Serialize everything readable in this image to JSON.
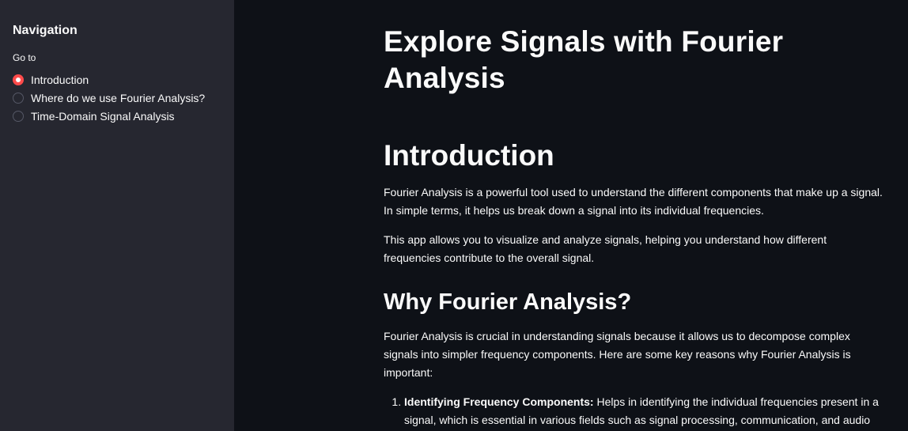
{
  "sidebar": {
    "title": "Navigation",
    "label": "Go to",
    "options": [
      {
        "label": "Introduction",
        "selected": true
      },
      {
        "label": "Where do we use Fourier Analysis?",
        "selected": false
      },
      {
        "label": "Time-Domain Signal Analysis",
        "selected": false
      }
    ]
  },
  "main": {
    "title": "Explore Signals with Fourier Analysis",
    "section_title": "Introduction",
    "intro_para_1": "Fourier Analysis is a powerful tool used to understand the different components that make up a signal. In simple terms, it helps us break down a signal into its individual frequencies.",
    "intro_para_2": "This app allows you to visualize and analyze signals, helping you understand how different frequencies contribute to the overall signal.",
    "why_title": "Why Fourier Analysis?",
    "why_para": "Fourier Analysis is crucial in understanding signals because it allows us to decompose complex signals into simpler frequency components. Here are some key reasons why Fourier Analysis is important:",
    "reasons": [
      {
        "bold": "Identifying Frequency Components:",
        "text": " Helps in identifying the individual frequencies present in a signal, which is essential in various fields such as signal processing, communication, and audio analysis."
      }
    ]
  },
  "colors": {
    "accent": "#ff4b4b",
    "sidebar_bg": "#262730",
    "main_bg": "#0e1117",
    "text": "#fafafa"
  }
}
